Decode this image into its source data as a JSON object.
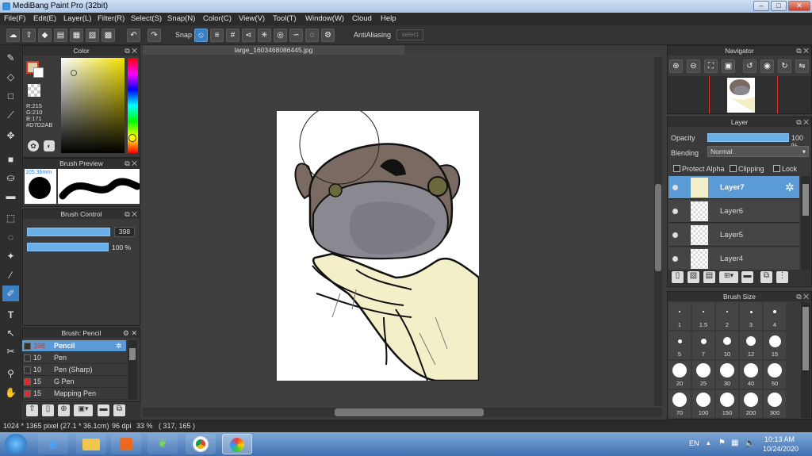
{
  "app": {
    "title": "MediBang Paint Pro (32bit)"
  },
  "window_buttons": {
    "minimize": "–",
    "restore": "□",
    "close": "✕"
  },
  "menu": [
    "File(F)",
    "Edit(E)",
    "Layer(L)",
    "Filter(R)",
    "Select(S)",
    "Snap(N)",
    "Color(C)",
    "View(V)",
    "Tool(T)",
    "Window(W)",
    "Cloud",
    "Help"
  ],
  "toolbar": {
    "snap_label": "Snap",
    "antialias_label": "AntiAliasing",
    "deselect_label": "select"
  },
  "color_panel": {
    "title": "Color",
    "r": "R:215",
    "g": "G:210",
    "b": "B:171",
    "hex": "#D7D2AB",
    "fg_color": "#D7D2AB"
  },
  "brush_preview": {
    "title": "Brush Preview",
    "size_label": "105.36mm"
  },
  "brush_control": {
    "title": "Brush Control",
    "size_value": "398",
    "opacity_value": "100 %"
  },
  "brush_list": {
    "title": "Brush: Pencil",
    "items": [
      {
        "size": "398",
        "name": "Pencil",
        "color": "#333333",
        "selected": true
      },
      {
        "size": "10",
        "name": "Pen",
        "color": "#333333"
      },
      {
        "size": "10",
        "name": "Pen (Sharp)",
        "color": "#333333"
      },
      {
        "size": "15",
        "name": "G Pen",
        "color": "#e02a2a"
      },
      {
        "size": "15",
        "name": "Mapping Pen",
        "color": "#e02a2a"
      }
    ]
  },
  "document": {
    "tab": "large_1603468086445.jpg"
  },
  "navigator": {
    "title": "Navigator"
  },
  "layer_panel": {
    "title": "Layer",
    "opacity_label": "Opacity",
    "opacity_value": "100 %",
    "opacity_level": 1.0,
    "blending_label": "Blending",
    "blending_value": "Normal",
    "protect_alpha": "Protect Alpha",
    "clipping": "Clipping",
    "lock": "Lock",
    "layers": [
      {
        "name": "Layer7",
        "selected": true
      },
      {
        "name": "Layer6"
      },
      {
        "name": "Layer5"
      },
      {
        "name": "Layer4"
      }
    ]
  },
  "brush_size_panel": {
    "title": "Brush Size",
    "sizes": [
      "1",
      "1.5",
      "2",
      "3",
      "4",
      "5",
      "7",
      "10",
      "12",
      "15",
      "20",
      "25",
      "30",
      "40",
      "50",
      "70",
      "100",
      "150",
      "200",
      "300"
    ]
  },
  "status": {
    "size": "1024 * 1365 pixel",
    "physical": "(27.1 * 36.1cm)",
    "dpi": "96 dpi",
    "zoom": "33 %",
    "coords": "( 317, 165 )"
  },
  "taskbar": {
    "lang": "EN",
    "time": "10:13 AM",
    "date": "10/24/2020"
  }
}
